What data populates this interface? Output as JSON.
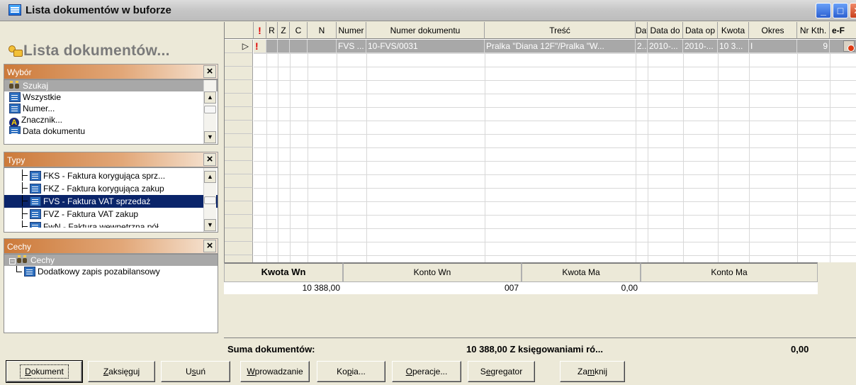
{
  "window": {
    "title": "Lista dokumentów w buforze"
  },
  "left": {
    "title": "Lista dokumentów...",
    "wybor": {
      "header": "Wybór",
      "items": [
        {
          "label": "Szukaj",
          "icon": "binoculars-icon"
        },
        {
          "label": "Wszystkie",
          "icon": "document-list-icon"
        },
        {
          "label": "Numer...",
          "icon": "document-list-icon"
        },
        {
          "label": "Znacznik...",
          "icon": "tag-icon"
        },
        {
          "label": "Data dokumentu",
          "icon": "document-list-icon"
        }
      ]
    },
    "typy": {
      "header": "Typy",
      "items": [
        {
          "label": "FKS - Faktura korygująca sprz..."
        },
        {
          "label": "FKZ - Faktura korygująca zakup"
        },
        {
          "label": "FVS - Faktura VAT sprzedaż"
        },
        {
          "label": "FVZ - Faktura VAT zakup"
        },
        {
          "label": "FwN - Faktura wewnętrzna pół"
        }
      ]
    },
    "cechy": {
      "header": "Cechy",
      "root": "Cechy",
      "items": [
        {
          "label": "Dodatkowy zapis pozabilansowy"
        }
      ]
    }
  },
  "grid": {
    "columns": [
      "!",
      "R",
      "Z",
      "C",
      "N",
      "Numer",
      "Numer dokumentu",
      "Treść",
      "Dat",
      "Data do",
      "Data op",
      "Kwota",
      "Okres",
      "Nr Kth.",
      "e-F"
    ],
    "row": {
      "indicator": "▷",
      "flag": "!",
      "numer": "FVS ...",
      "numer_dokumentu": "10-FVS/0031",
      "tresc": "Pralka \"Diana 12F\"/Pralka \"W...",
      "dat": "2...",
      "data_do": "2010-...",
      "data_op": "2010-...",
      "kwota": "10 3...",
      "okres": "I",
      "nr_kth": "9"
    }
  },
  "booking": {
    "headers": [
      "Kwota Wn",
      "Konto Wn",
      "Kwota Ma",
      "Konto Ma"
    ],
    "row": {
      "kwota_wn": "10 388,00",
      "konto_wn": "007",
      "kwota_ma": "0,00",
      "konto_ma": ""
    }
  },
  "summary": {
    "label": "Suma dokumentów:",
    "amount": "10 388,00 Z księgowaniami ró...",
    "right": "0,00"
  },
  "buttons": [
    {
      "label": "Dokument",
      "key": "D"
    },
    {
      "label": "Zaksięguj",
      "key": "Z"
    },
    {
      "label": "Usuń",
      "key": "s"
    },
    {
      "label": "Wprowadzanie",
      "key": "W"
    },
    {
      "label": "Kopia...",
      "key": "p"
    },
    {
      "label": "Operacje...",
      "key": "O"
    },
    {
      "label": "Segregator",
      "key": "e"
    },
    {
      "label": "Zamknij",
      "key": "m"
    }
  ]
}
